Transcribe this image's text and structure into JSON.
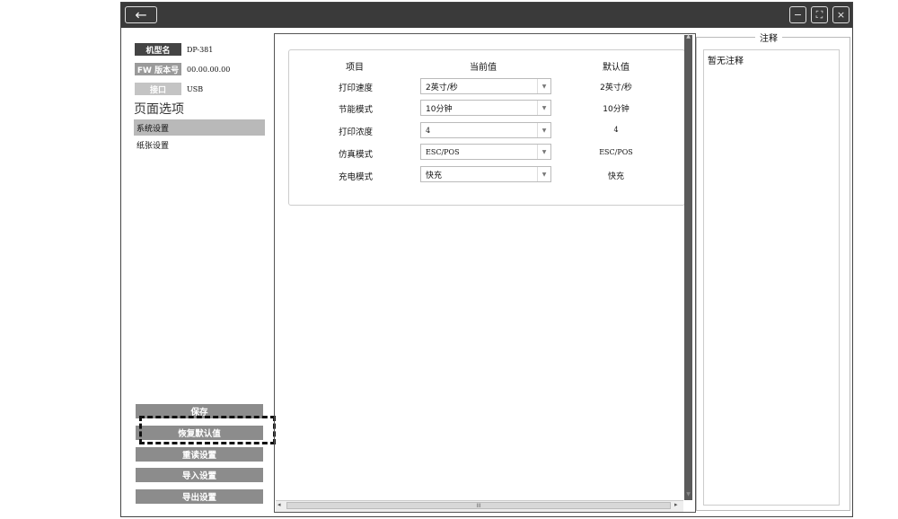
{
  "titlebar": {
    "back_icon": "←",
    "minimize_icon": "−",
    "maximize_icon": "⛶",
    "close_icon": "×"
  },
  "device_info": [
    {
      "label": "机型名",
      "value": "DP-381"
    },
    {
      "label": "FW 版本号",
      "value": "00.00.00.00"
    },
    {
      "label": "接口",
      "value": "USB"
    }
  ],
  "sidebar": {
    "section_title": "页面选项",
    "items": [
      {
        "label": "系统设置",
        "active": true
      },
      {
        "label": "纸张设置",
        "active": false
      }
    ],
    "buttons": {
      "save": "保存",
      "restore_defaults": "恢复默认值",
      "reload": "重读设置",
      "import": "导入设置",
      "export": "导出设置"
    }
  },
  "table": {
    "headers": {
      "item": "项目",
      "current": "当前值",
      "default": "默认值"
    },
    "rows": [
      {
        "label": "打印速度",
        "current": "2英寸/秒",
        "default": "2英寸/秒"
      },
      {
        "label": "节能模式",
        "current": "10分钟",
        "default": "10分钟"
      },
      {
        "label": "打印浓度",
        "current": "4",
        "default": "4"
      },
      {
        "label": "仿真模式",
        "current": "ESC/POS",
        "default": "ESC/POS"
      },
      {
        "label": "充电模式",
        "current": "快充",
        "default": "快充"
      }
    ]
  },
  "notes": {
    "title": "注释",
    "content": "暂无注释"
  },
  "scrollbar": {
    "thumb_grip": "III"
  }
}
